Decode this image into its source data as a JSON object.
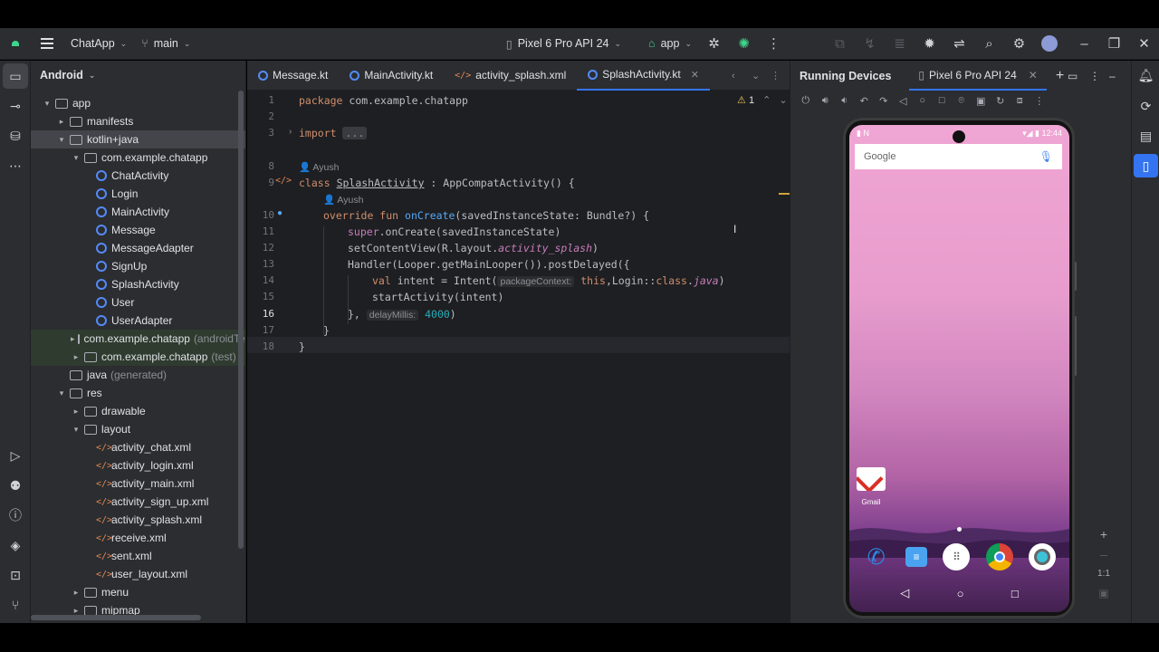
{
  "titlebar": {
    "project": "ChatApp",
    "branch": "main",
    "device": "Pixel 6 Pro API 24",
    "run_config": "app"
  },
  "project_panel": {
    "view": "Android",
    "tree": [
      {
        "label": "app",
        "depth": 0,
        "arrow": "▾",
        "type": "folder"
      },
      {
        "label": "manifests",
        "depth": 1,
        "arrow": "▸",
        "type": "folder"
      },
      {
        "label": "kotlin+java",
        "depth": 1,
        "arrow": "▾",
        "type": "folder",
        "selected": true
      },
      {
        "label": "com.example.chatapp",
        "depth": 2,
        "arrow": "▾",
        "type": "package"
      },
      {
        "label": "ChatActivity",
        "depth": 3,
        "arrow": "",
        "type": "kotlin"
      },
      {
        "label": "Login",
        "depth": 3,
        "arrow": "",
        "type": "kotlin"
      },
      {
        "label": "MainActivity",
        "depth": 3,
        "arrow": "",
        "type": "kotlin"
      },
      {
        "label": "Message",
        "depth": 3,
        "arrow": "",
        "type": "kotlin"
      },
      {
        "label": "MessageAdapter",
        "depth": 3,
        "arrow": "",
        "type": "kotlin"
      },
      {
        "label": "SignUp",
        "depth": 3,
        "arrow": "",
        "type": "kotlin"
      },
      {
        "label": "SplashActivity",
        "depth": 3,
        "arrow": "",
        "type": "kotlin"
      },
      {
        "label": "User",
        "depth": 3,
        "arrow": "",
        "type": "kotlin"
      },
      {
        "label": "UserAdapter",
        "depth": 3,
        "arrow": "",
        "type": "kotlin"
      },
      {
        "label": "com.example.chatapp",
        "suffix": "(androidTest)",
        "depth": 2,
        "arrow": "▸",
        "type": "package",
        "green": true
      },
      {
        "label": "com.example.chatapp",
        "suffix": "(test)",
        "depth": 2,
        "arrow": "▸",
        "type": "package",
        "green": true
      },
      {
        "label": "java",
        "suffix": "(generated)",
        "depth": 1,
        "arrow": "",
        "type": "folder"
      },
      {
        "label": "res",
        "depth": 1,
        "arrow": "▾",
        "type": "folder"
      },
      {
        "label": "drawable",
        "depth": 2,
        "arrow": "▸",
        "type": "folder"
      },
      {
        "label": "layout",
        "depth": 2,
        "arrow": "▾",
        "type": "folder"
      },
      {
        "label": "activity_chat.xml",
        "depth": 3,
        "arrow": "",
        "type": "xml"
      },
      {
        "label": "activity_login.xml",
        "depth": 3,
        "arrow": "",
        "type": "xml"
      },
      {
        "label": "activity_main.xml",
        "depth": 3,
        "arrow": "",
        "type": "xml"
      },
      {
        "label": "activity_sign_up.xml",
        "depth": 3,
        "arrow": "",
        "type": "xml"
      },
      {
        "label": "activity_splash.xml",
        "depth": 3,
        "arrow": "",
        "type": "xml"
      },
      {
        "label": "receive.xml",
        "depth": 3,
        "arrow": "",
        "type": "xml"
      },
      {
        "label": "sent.xml",
        "depth": 3,
        "arrow": "",
        "type": "xml"
      },
      {
        "label": "user_layout.xml",
        "depth": 3,
        "arrow": "",
        "type": "xml"
      },
      {
        "label": "menu",
        "depth": 2,
        "arrow": "▸",
        "type": "folder"
      },
      {
        "label": "mipmap",
        "depth": 2,
        "arrow": "▸",
        "type": "folder"
      }
    ]
  },
  "editor": {
    "tabs": [
      {
        "label": "Message.kt",
        "type": "kotlin"
      },
      {
        "label": "MainActivity.kt",
        "type": "kotlin"
      },
      {
        "label": "activity_splash.xml",
        "type": "xml"
      },
      {
        "label": "SplashActivity.kt",
        "type": "kotlin",
        "active": true
      }
    ],
    "warning_count": "1",
    "author": "Ayush",
    "line_numbers": [
      "1",
      "2",
      "3",
      "8",
      "9",
      "10",
      "11",
      "12",
      "13",
      "14",
      "15",
      "16",
      "17",
      "18"
    ],
    "code": {
      "l1_kw": "package",
      "l1_rest": " com.example.chatapp",
      "l3_kw": "import",
      "l3_fold": "...",
      "l9_kw": "class",
      "l9_cls": "SplashActivity",
      "l9_rest": " : AppCompatActivity() {",
      "l10_kw": "override fun",
      "l10_fn": "onCreate",
      "l10_rest": "(savedInstanceState: Bundle?) {",
      "l11_sup": "super",
      "l11_rest": ".onCreate(savedInstanceState)",
      "l12_a": "setContentView(R.layout.",
      "l12_ital": "activity_splash",
      "l12_b": ")",
      "l13": "Handler(Looper.getMainLooper()).postDelayed({",
      "l14_kw": "val",
      "l14_a": " intent = Intent(",
      "l14_hint": "packageContext:",
      "l14_kw2": "this",
      "l14_b": ",Login::",
      "l14_kw3": "class",
      "l14_c": ".",
      "l14_ital": "java",
      "l14_d": ")",
      "l15": "startActivity(intent)",
      "l16_a": "},",
      "l16_hint": "delayMillis:",
      "l16_num": "4000",
      "l16_b": ")",
      "l17": "}",
      "l18": "}"
    }
  },
  "devices": {
    "panel_title": "Running Devices",
    "tab_label": "Pixel 6 Pro API 24",
    "phone": {
      "time": "12:44",
      "search_logo": "Google",
      "gmail_label": "Gmail"
    },
    "zoom_label": "1:1"
  }
}
